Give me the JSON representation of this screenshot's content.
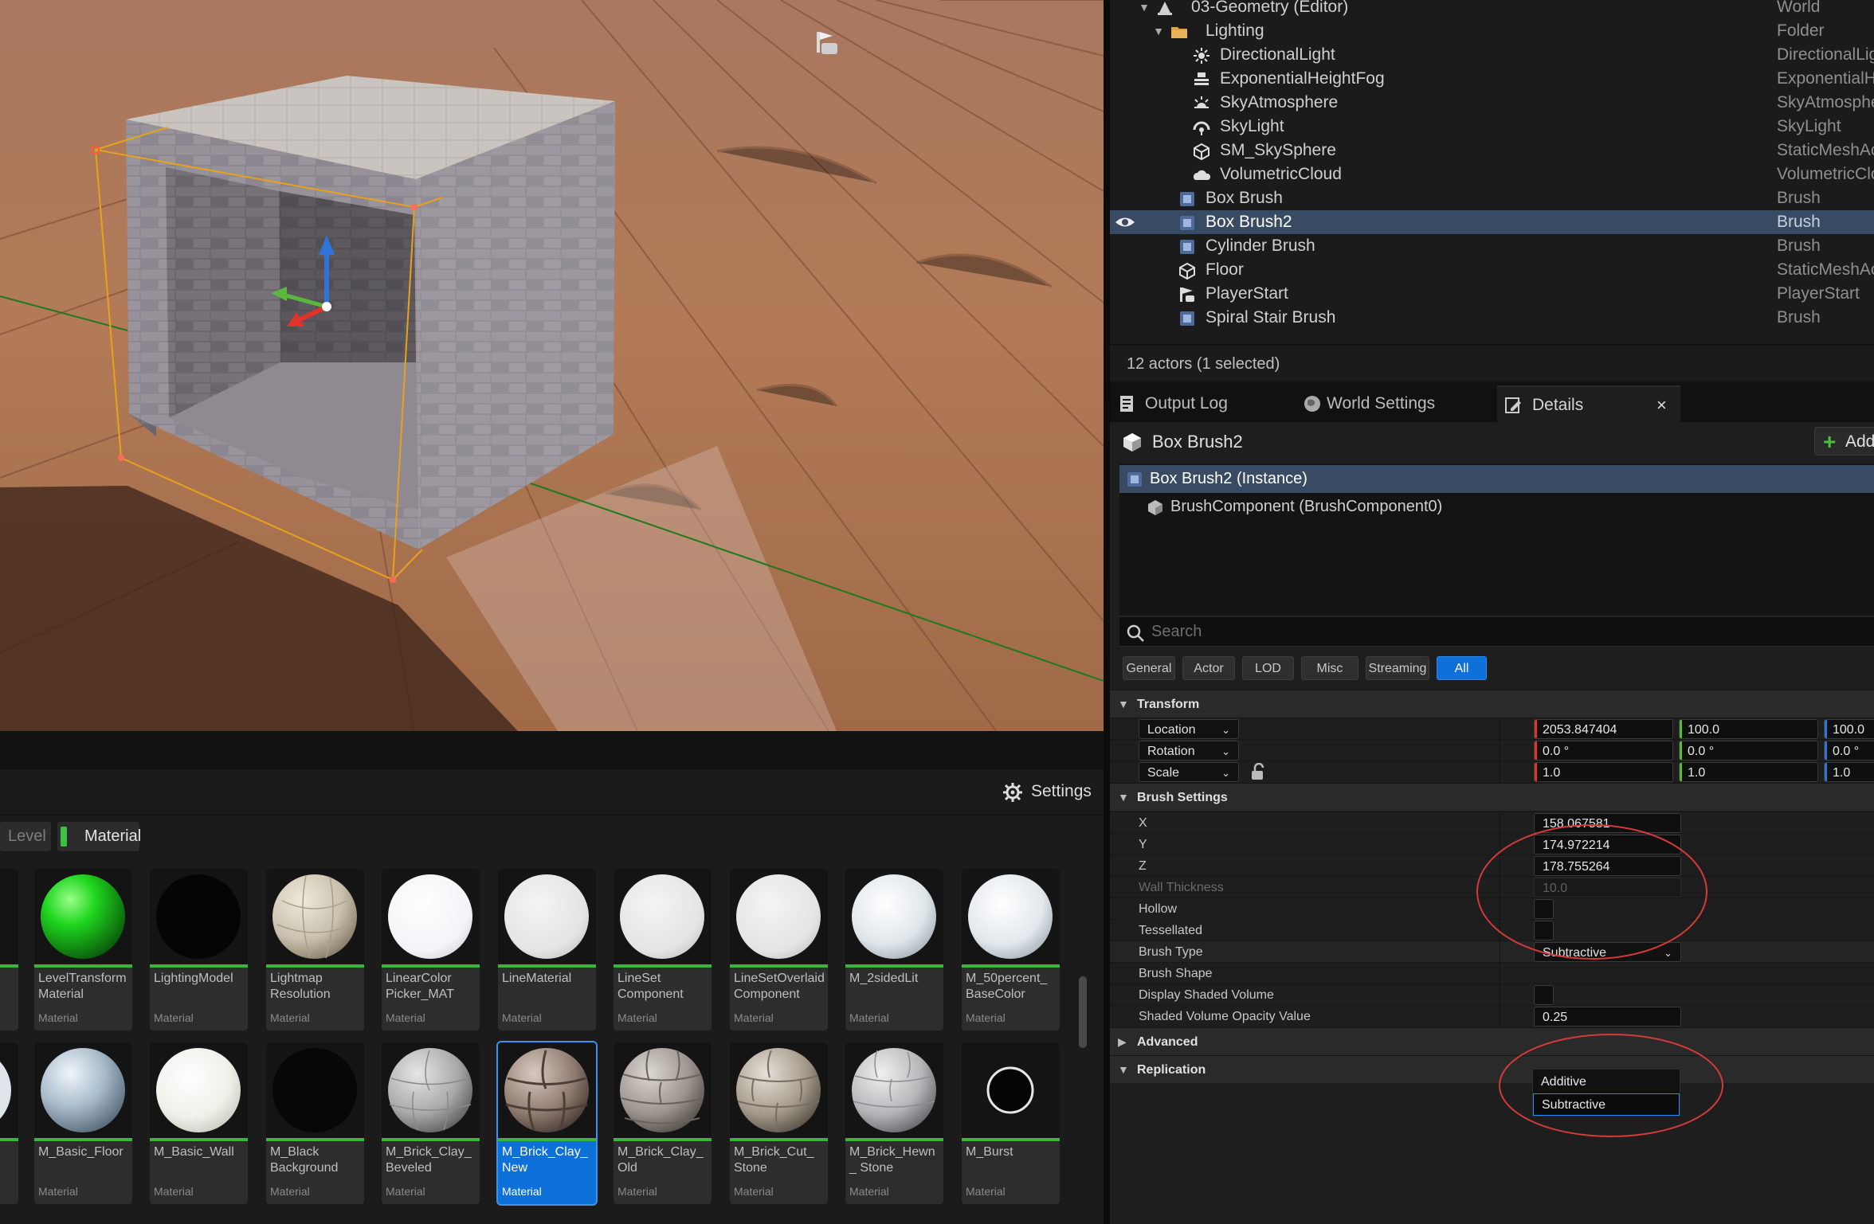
{
  "outliner": {
    "rows": [
      {
        "name": "03-Geometry (Editor)",
        "type": "World"
      },
      {
        "name": "Lighting",
        "type": "Folder"
      },
      {
        "name": "DirectionalLight",
        "type": "DirectionalLig"
      },
      {
        "name": "ExponentialHeightFog",
        "type": "ExponentialHe"
      },
      {
        "name": "SkyAtmosphere",
        "type": "SkyAtmosphe"
      },
      {
        "name": "SkyLight",
        "type": "SkyLight"
      },
      {
        "name": "SM_SkySphere",
        "type": "StaticMeshAc"
      },
      {
        "name": "VolumetricCloud",
        "type": "VolumetricClo"
      },
      {
        "name": "Box Brush",
        "type": "Brush"
      },
      {
        "name": "Box Brush2",
        "type": "Brush"
      },
      {
        "name": "Cylinder Brush",
        "type": "Brush"
      },
      {
        "name": "Floor",
        "type": "StaticMeshAc"
      },
      {
        "name": "PlayerStart",
        "type": "PlayerStart"
      },
      {
        "name": "Spiral Stair Brush",
        "type": "Brush"
      }
    ],
    "status": "12 actors (1 selected)"
  },
  "tabs": {
    "output_log": "Output Log",
    "world_settings": "World Settings",
    "details": "Details",
    "close": "×"
  },
  "details": {
    "title": "Box Brush2",
    "add_label": "Add",
    "components": {
      "instance": "Box Brush2 (Instance)",
      "brush_component": "BrushComponent (BrushComponent0)"
    },
    "search_placeholder": "Search",
    "filters": [
      "General",
      "Actor",
      "LOD",
      "Misc",
      "Streaming",
      "All"
    ],
    "transform": {
      "section": "Transform",
      "location_label": "Location",
      "rotation_label": "Rotation",
      "scale_label": "Scale",
      "location": [
        "2053.847404",
        "100.0",
        "100.0"
      ],
      "rotation": [
        "0.0 °",
        "0.0 °",
        "0.0 °"
      ],
      "scale": [
        "1.0",
        "1.0",
        "1.0"
      ]
    },
    "brush_settings": {
      "section": "Brush Settings",
      "x_label": "X",
      "x": "158.067581",
      "y_label": "Y",
      "y": "174.972214",
      "z_label": "Z",
      "z": "178.755264",
      "wall_label": "Wall Thickness",
      "wall": "10.0",
      "hollow_label": "Hollow",
      "tess_label": "Tessellated",
      "type_label": "Brush Type",
      "type_value": "Subtractive",
      "type_options": [
        "Additive",
        "Subtractive"
      ],
      "shape_label": "Brush Shape",
      "display_label": "Display Shaded Volume",
      "opacity_label": "Shaded Volume Opacity Value",
      "opacity": "0.25"
    },
    "advanced": "Advanced",
    "replication": "Replication"
  },
  "content_browser": {
    "settings_label": "Settings",
    "filter_level": "Level",
    "filter_material": "Material",
    "row1": [
      {
        "name": "",
        "type": ""
      },
      {
        "name": "LevelTransform Material",
        "type": "Material"
      },
      {
        "name": "LightingModel",
        "type": "Material"
      },
      {
        "name": "Lightmap Resolution",
        "type": "Material"
      },
      {
        "name": "LinearColor Picker_MAT",
        "type": "Material"
      },
      {
        "name": "LineMaterial",
        "type": "Material"
      },
      {
        "name": "LineSet Component",
        "type": "Material"
      },
      {
        "name": "LineSetOverlaid Component",
        "type": "Material"
      },
      {
        "name": "M_2sidedLit",
        "type": "Material"
      },
      {
        "name": "M_50percent_ BaseColor",
        "type": "Material"
      }
    ],
    "row2": [
      {
        "name": "",
        "type": ""
      },
      {
        "name": "M_Basic_Floor",
        "type": "Material"
      },
      {
        "name": "M_Basic_Wall",
        "type": "Material"
      },
      {
        "name": "M_Black Background",
        "type": "Material"
      },
      {
        "name": "M_Brick_Clay_ Beveled",
        "type": "Material"
      },
      {
        "name": "M_Brick_Clay_ New",
        "type": "Material"
      },
      {
        "name": "M_Brick_Clay_ Old",
        "type": "Material"
      },
      {
        "name": "M_Brick_Cut_ Stone",
        "type": "Material"
      },
      {
        "name": "M_Brick_Hewn_ Stone",
        "type": "Material"
      },
      {
        "name": "M_Burst",
        "type": "Material"
      }
    ]
  },
  "colors": {
    "selection": "#384b63",
    "accent_blue": "#0e70d9",
    "axis_x": "#e0342a",
    "axis_y": "#5ab83a",
    "axis_z": "#2f74d6",
    "annotation": "#d23a3a"
  }
}
